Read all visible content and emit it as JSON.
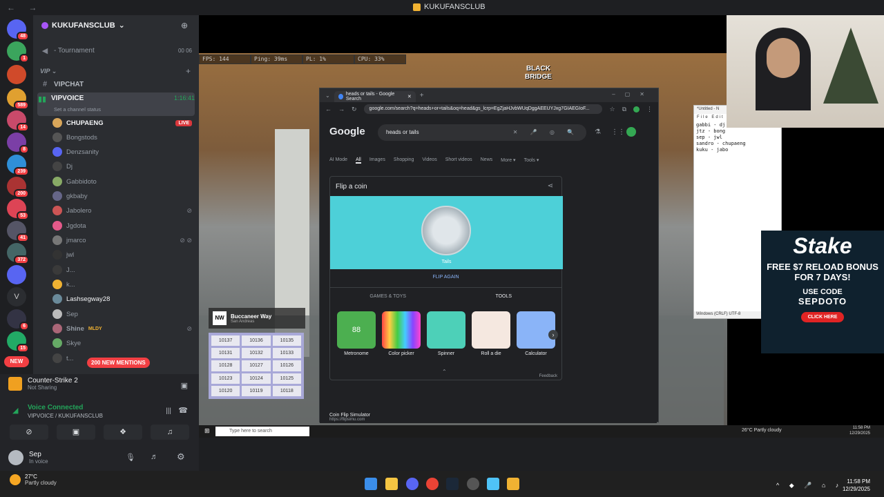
{
  "window": {
    "title": "KUKUFANSCLUB",
    "nav": "← →"
  },
  "server": {
    "name": "KUKUFANSCLUB",
    "chevron": "⌄"
  },
  "rail_badges": [
    "48",
    "1",
    "589",
    "14",
    "8",
    "239",
    "200",
    "53",
    "41",
    "372",
    "6",
    "15"
  ],
  "rail_new": "NEW",
  "channels": {
    "tournament": "- Tournament",
    "tournament_count": "00  06",
    "vip_category": "VIP",
    "vipchat": "VIPCHAT",
    "vipvoice": "VIPVOICE",
    "vipvoice_time": "1:16:41",
    "channel_status": "Set a channel status"
  },
  "members": [
    {
      "name": "CHUPAENG",
      "color": "#e9eaed",
      "badge": "LIVE"
    },
    {
      "name": "Bongstods"
    },
    {
      "name": "Denzsanity"
    },
    {
      "name": "Dj"
    },
    {
      "name": "Gabbidoto"
    },
    {
      "name": "gkbaby"
    },
    {
      "name": "Jabolero"
    },
    {
      "name": "Jgdota"
    },
    {
      "name": "jmarco"
    },
    {
      "name": "jwl"
    },
    {
      "name": "J..."
    },
    {
      "name": "k..."
    },
    {
      "name": "Lashsegway28",
      "color": "#e9eaed"
    },
    {
      "name": "Sep"
    },
    {
      "name": "Shine",
      "tag": "MLDY"
    },
    {
      "name": "Skye"
    },
    {
      "name": "t..."
    }
  ],
  "mentions": "200 NEW MENTIONS",
  "panel": {
    "game": "Counter-Strike 2",
    "game_sub": "Not Sharing",
    "voice": "Voice Connected",
    "voice_channel": "VIPVOICE / KUKUFANSCLUB",
    "user": "Sep",
    "user_status": "In voice"
  },
  "hud": [
    "FPS: 144",
    "Ping: 39ms",
    "PL: 1%",
    "CPU: 33%"
  ],
  "game_logo": [
    "BLACK",
    "BRIDGE"
  ],
  "chrome": {
    "tab_title": "heads or tails - Google Search",
    "url": "google.com/search?q=heads+or+tails&oq=head&gs_lcrp=EgZjaHJvbWUqDggAEEUYJxg7GIAEGIoF...",
    "search_query": "heads or tails",
    "logo": "Google",
    "tabs": [
      "AI Mode",
      "All",
      "Images",
      "Shopping",
      "Videos",
      "Short videos",
      "News",
      "More ▾",
      "Tools ▾"
    ],
    "card_title": "Flip a coin",
    "coin_result": "Tails",
    "flip_again": "FLIP AGAIN",
    "card_tabs": [
      "GAMES & TOYS",
      "TOOLS"
    ],
    "tools": [
      "Metronome",
      "Color picker",
      "Spinner",
      "Roll a die",
      "Calculator"
    ],
    "metronome_value": "88",
    "feedback": "Feedback",
    "result": "Coin Flip Simulator",
    "result_url": "https://flipsimu.com"
  },
  "notepad": {
    "title": "*Untitled - N",
    "menu": "File  Edit  For",
    "text": "gabbi - dj\njtz - bong\nsep - jwl\nsandro - chupaeng\nkuku - jabo",
    "status": "Windows (CRLF)    UTF-8"
  },
  "stake": {
    "logo": "Stake",
    "promo": "FREE $7 RELOAD BONUS FOR 7 DAYS!",
    "use_code": "USE CODE",
    "code": "SEPDOTO",
    "cta": "CLICK HERE"
  },
  "phone": {
    "title": "Buccaneer Way",
    "sub": "San Andreas",
    "logo": "NW",
    "plates": [
      "10137",
      "10136",
      "10135",
      "10131",
      "10132",
      "10133",
      "10128",
      "10127",
      "10126",
      "10123",
      "10124",
      "10125",
      "10120",
      "10119",
      "10118"
    ]
  },
  "inner_taskbar": {
    "search": "Type here to search",
    "weather": "26°C  Partly cloudy",
    "time": "11:58 PM",
    "date": "12/29/2025"
  },
  "taskbar": {
    "temp": "27°C",
    "weather": "Partly cloudy",
    "time": "11:58 PM",
    "date": "12/29/2025"
  }
}
